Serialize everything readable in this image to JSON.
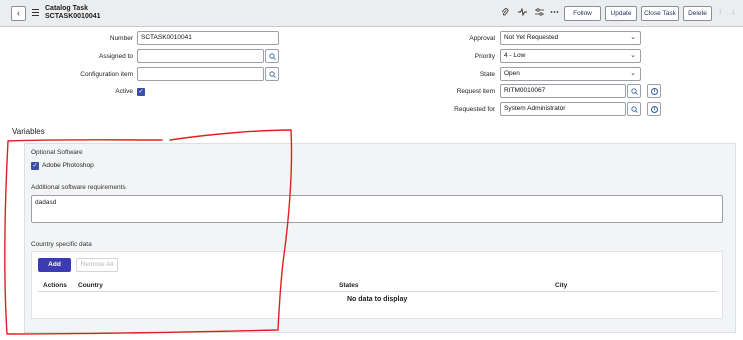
{
  "header": {
    "title": "Catalog Task",
    "number": "SCTASK0010041",
    "buttons": {
      "follow": "Follow",
      "update": "Update",
      "close_task": "Close Task",
      "delete": "Delete"
    },
    "icons": [
      "paperclip-icon",
      "activity-icon",
      "settings-icon",
      "more-icon"
    ]
  },
  "form": {
    "labels": {
      "number": "Number",
      "assigned_to": "Assigned to",
      "configuration_item": "Configuration item",
      "active": "Active",
      "approval": "Approval",
      "priority": "Priority",
      "state": "State",
      "request_item": "Request item",
      "requested_for": "Requested for"
    },
    "values": {
      "number": "SCTASK0010041",
      "assigned_to": "",
      "configuration_item": "",
      "approval": "Not Yet Requested",
      "priority": "4 - Low",
      "state": "Open",
      "request_item": "RITM0010067",
      "requested_for": "System Administrator"
    }
  },
  "variables": {
    "title": "Variables",
    "optional_software_label": "Optional Software",
    "adobe_photoshop": "Adobe Photoshop",
    "additional_requirements_label": "Additional software requirements",
    "additional_requirements_value": "dadasd",
    "country_specific_label": "Country specific data",
    "add_button": "Add",
    "remove_all_button": "Remove All",
    "columns": [
      "Actions",
      "Country",
      "States",
      "City"
    ],
    "no_data": "No data to display"
  },
  "colors": {
    "accent": "#3c3bb3",
    "annotation": "#e02020",
    "header_bg": "#ecedee"
  }
}
